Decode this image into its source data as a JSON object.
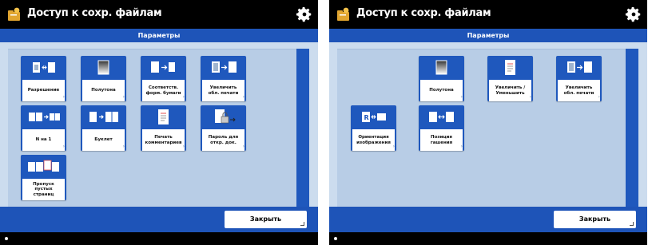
{
  "left_screen": {
    "title": "Доступ к сохр. файлам",
    "icons": {
      "app": "folder-access-icon",
      "settings": "gear-icon"
    },
    "panel_title": "Параметры",
    "tiles": [
      {
        "label": "Разрешение",
        "icon": "resolution-icon"
      },
      {
        "label": "Полутона",
        "icon": "halftone-icon"
      },
      {
        "label": "Соответств. форм. бумаги",
        "icon": "paper-size-match-icon"
      },
      {
        "label": "Увеличить обл. печати",
        "icon": "enlarge-print-area-icon"
      },
      {
        "label": "N на 1",
        "icon": "n-on-1-icon"
      },
      {
        "label": "Буклет",
        "icon": "booklet-icon"
      },
      {
        "label": "Печать комментариев",
        "icon": "print-comments-icon"
      },
      {
        "label": "Пароль для откр. док.",
        "icon": "document-password-icon"
      },
      {
        "label": "Пропуск пустых страниц",
        "icon": "skip-blank-pages-icon"
      }
    ],
    "close_label": "Закрыть"
  },
  "right_screen": {
    "title": "Доступ к сохр. файлам",
    "icons": {
      "app": "folder-access-icon",
      "settings": "gear-icon"
    },
    "panel_title": "Параметры",
    "tiles": [
      {
        "label": "Полутона",
        "icon": "halftone-icon"
      },
      {
        "label": "Увеличить / Уменьшить",
        "icon": "zoom-icon"
      },
      {
        "label": "Увеличить обл. печати",
        "icon": "enlarge-print-area-icon"
      },
      {
        "label": "Ориентация изображения",
        "icon": "image-orientation-icon"
      },
      {
        "label": "Позиция гашения",
        "icon": "erase-position-icon"
      }
    ],
    "close_label": "Закрыть"
  },
  "colors": {
    "header_blue": "#1e54b8",
    "panel_light": "#ccdcee",
    "panel_area": "#b8cde6"
  }
}
